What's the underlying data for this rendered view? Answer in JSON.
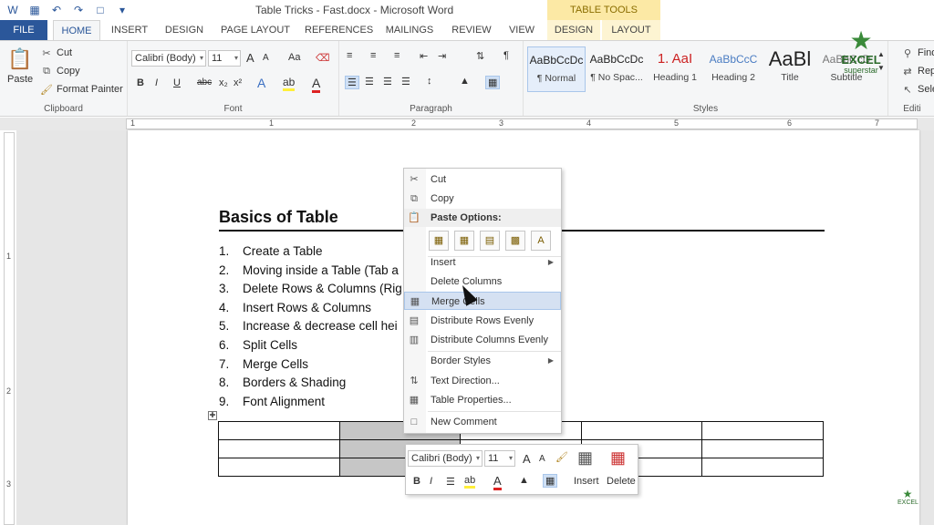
{
  "window": {
    "title": "Table Tricks - Fast.docx - Microsoft Word",
    "table_tools": "TABLE TOOLS"
  },
  "tabs": [
    "FILE",
    "HOME",
    "INSERT",
    "DESIGN",
    "PAGE LAYOUT",
    "REFERENCES",
    "MAILINGS",
    "REVIEW",
    "VIEW",
    "DESIGN",
    "LAYOUT"
  ],
  "ribbon": {
    "clipboard": {
      "label": "Clipboard",
      "paste": "Paste",
      "cut": "Cut",
      "copy": "Copy",
      "format_painter": "Format Painter"
    },
    "font": {
      "label": "Font",
      "font_name": "Calibri (Body)",
      "font_size": "11",
      "grow": "A",
      "shrink": "A",
      "case": "Aa",
      "bold": "B",
      "italic": "I",
      "underline": "U",
      "strike": "abc",
      "sub": "x₂",
      "sup": "x²"
    },
    "paragraph": {
      "label": "Paragraph"
    },
    "styles": {
      "label": "Styles",
      "items": [
        {
          "preview": "AaBbCcDc",
          "name": "¶ Normal"
        },
        {
          "preview": "AaBbCcDc",
          "name": "¶ No Spac..."
        },
        {
          "preview": "1. AaI",
          "name": "Heading 1"
        },
        {
          "preview": "AaBbCcC",
          "name": "Heading 2"
        },
        {
          "preview": "AaBl",
          "name": "Title"
        },
        {
          "preview": "AaBbCcD",
          "name": "Subtitle"
        }
      ]
    },
    "editing": {
      "label": "Editi",
      "find": "Find",
      "replace": "Rep",
      "select": "Sele"
    }
  },
  "logo": {
    "line1": "EXCEL",
    "line2": "superstar"
  },
  "ruler": {
    "h": [
      "1",
      "1",
      "2",
      "3",
      "4",
      "5",
      "6",
      "7"
    ],
    "v": [
      "1",
      "2",
      "3"
    ]
  },
  "document": {
    "heading": "Basics of Table",
    "list": [
      {
        "n": "1.",
        "t": "Create a Table"
      },
      {
        "n": "2.",
        "t": "Moving inside a Table (Tab a"
      },
      {
        "n": "3.",
        "t": "Delete Rows & Columns (Rig"
      },
      {
        "n": "4.",
        "t": "Insert Rows & Columns"
      },
      {
        "n": "5.",
        "t": "Increase & decrease cell hei"
      },
      {
        "n": "6.",
        "t": "Split Cells"
      },
      {
        "n": "7.",
        "t": "Merge Cells"
      },
      {
        "n": "8.",
        "t": "Borders & Shading"
      },
      {
        "n": "9.",
        "t": "Font Alignment"
      }
    ]
  },
  "context_menu": {
    "cut": "Cut",
    "copy": "Copy",
    "paste_options": "Paste Options:",
    "insert": "Insert",
    "delete_columns": "Delete Columns",
    "merge_cells": "Merge Cells",
    "distribute_rows": "Distribute Rows Evenly",
    "distribute_cols": "Distribute Columns Evenly",
    "border_styles": "Border Styles",
    "text_direction": "Text Direction...",
    "table_properties": "Table Properties...",
    "new_comment": "New Comment"
  },
  "mini_toolbar": {
    "font_name": "Calibri (Body)",
    "font_size": "11",
    "insert": "Insert",
    "delete": "Delete",
    "bold": "B",
    "italic": "I"
  }
}
